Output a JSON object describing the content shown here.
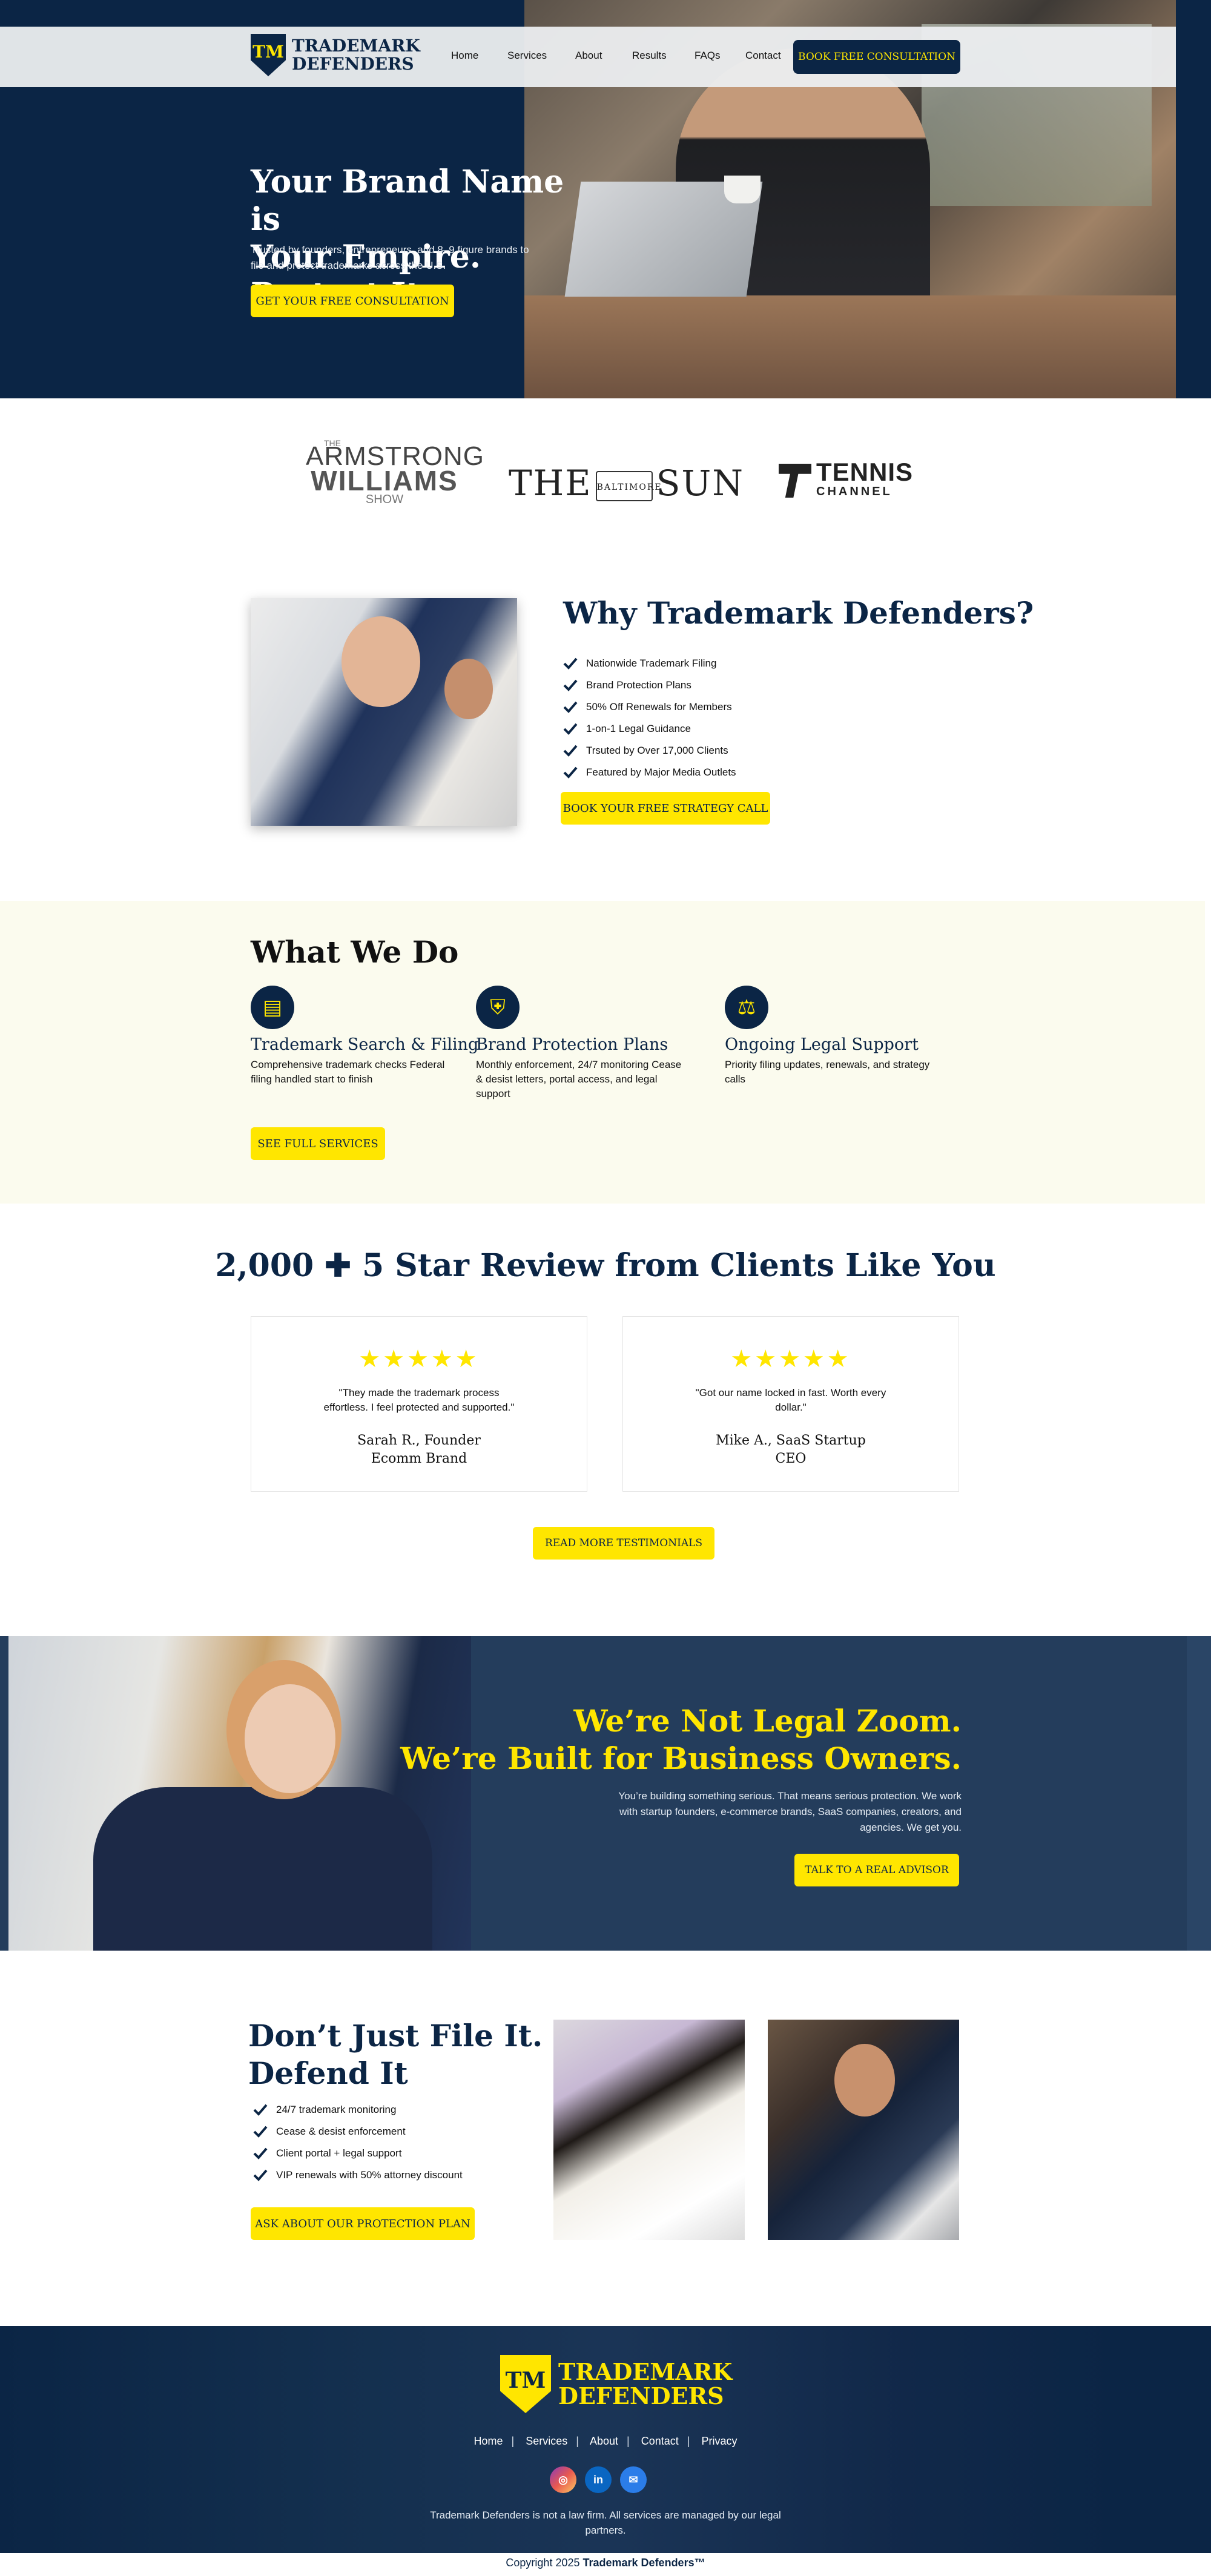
{
  "brand": {
    "logo_mark": "TM",
    "name_line1": "TRADEMARK",
    "name_line2": "DEFENDERS"
  },
  "nav": {
    "items": [
      "Home",
      "Services",
      "About",
      "Results",
      "FAQs",
      "Contact"
    ],
    "cta": "BOOK FREE CONSULTATION"
  },
  "hero": {
    "title_line1": "Your Brand Name is",
    "title_line2": "Your Empire. Protect It",
    "subtitle": "Trusted by founders, entrepreneurs, and 8–9 figure brands to file and protect trademarks across the U.S.",
    "cta": "GET YOUR FREE CONSULTATION"
  },
  "media": {
    "armstrong_the": "THE",
    "armstrong_line1": "ARMSTRONG",
    "armstrong_line2": "WILLIAMS",
    "armstrong_line3": "SHOW",
    "sun_the": "THE",
    "sun_seal": "BALTIMORE",
    "sun_sun": "SUN",
    "tennis_line1": "TENNIS",
    "tennis_line2": "CHANNEL"
  },
  "why": {
    "title": "Why Trademark Defenders?",
    "items": [
      "Nationwide Trademark Filing",
      "Brand Protection Plans",
      "50% Off Renewals for Members",
      "1-on-1 Legal Guidance",
      "Trsuted by Over 17,000 Clients",
      "Featured by Major Media Outlets"
    ],
    "cta": "BOOK YOUR FREE STRATEGY CALL"
  },
  "what": {
    "title": "What We Do",
    "services": [
      {
        "icon": "trademark-document-icon",
        "title": "Trademark Search & Filing",
        "desc": "Comprehensive trademark checks Federal filing handled start to finish"
      },
      {
        "icon": "shield-check-icon",
        "title": "Brand Protection Plans",
        "desc": "Monthly enforcement, 24/7 monitoring Cease & desist letters, portal access, and legal support"
      },
      {
        "icon": "hand-scales-icon",
        "title": "Ongoing Legal Support",
        "desc": "Priority filing updates, renewals, and strategy calls"
      }
    ],
    "cta": "SEE FULL SERVICES"
  },
  "reviews": {
    "title": "2,000 ✚ 5 Star Review from Clients Like You",
    "stars": "★★★★★",
    "items": [
      {
        "quote": "\"They made the trademark process effortless. I feel protected and supported.\"",
        "author_line1": "Sarah R., Founder",
        "author_line2": "Ecomm Brand"
      },
      {
        "quote": "\"Got our name locked in fast. Worth every dollar.\"",
        "author_line1": "Mike A., SaaS Startup",
        "author_line2": "CEO"
      }
    ],
    "cta": "READ MORE TESTIMONIALS"
  },
  "zoom": {
    "title_line1": "We’re Not Legal Zoom.",
    "title_line2": "We’re Built for Business Owners.",
    "text": "You’re building something serious. That means serious protection. We work with startup founders, e-commerce brands, SaaS companies, creators, and agencies. We get you.",
    "cta": "TALK TO A REAL ADVISOR"
  },
  "defend": {
    "title_line1": "Don’t Just File It.",
    "title_line2": "Defend It",
    "items": [
      "24/7 trademark monitoring",
      "Cease & desist enforcement",
      "Client portal + legal support",
      "VIP renewals with 50% attorney discount"
    ],
    "cta": "ASK ABOUT OUR PROTECTION PLAN"
  },
  "footer": {
    "nav": [
      "Home",
      "Services",
      "About",
      "Contact",
      "Privacy"
    ],
    "separator": "|",
    "social": [
      {
        "name": "instagram-icon",
        "glyph": "◎"
      },
      {
        "name": "linkedin-icon",
        "glyph": "in"
      },
      {
        "name": "email-icon",
        "glyph": "✉"
      }
    ],
    "note": "Trademark Defenders is not a law firm. All services are managed by our legal partners.",
    "copyright_prefix": "Copyright 2025 ",
    "copyright_brand": "Trademark Defenders™"
  },
  "colors": {
    "navy": "#0b2545",
    "yellow": "#ffe600",
    "cream": "#fbfbee"
  }
}
